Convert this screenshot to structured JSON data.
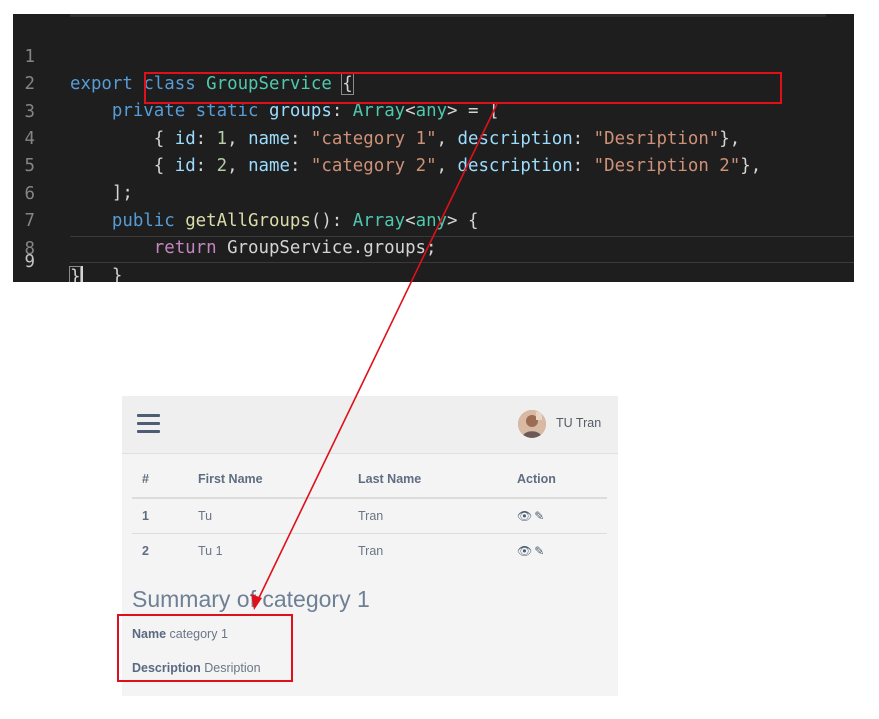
{
  "editor": {
    "lines": [
      {
        "num": "1"
      },
      {
        "num": "2"
      },
      {
        "num": "3"
      },
      {
        "num": "4"
      },
      {
        "num": "5"
      },
      {
        "num": "6"
      },
      {
        "num": "7"
      },
      {
        "num": "8"
      },
      {
        "num": "9"
      }
    ],
    "tokens": {
      "l1_export": "export",
      "l1_class": "class",
      "l1_name": "GroupService",
      "l1_brace": "{",
      "l2_private": "private",
      "l2_static": "static",
      "l2_groups": "groups",
      "l2_colon": ":",
      "l2_array": "Array",
      "l2_lt": "<",
      "l2_any": "any",
      "l2_gt": ">",
      "l2_eq": " = [",
      "l3_open": "{ ",
      "l3_id_key": "id",
      "l3_id_val": "1",
      "l3_name_key": "name",
      "l3_name_val": "\"category 1\"",
      "l3_desc_key": "description",
      "l3_desc_val": "\"Desription\"",
      "l3_close": "},",
      "l4_open": "{ ",
      "l4_id_key": "id",
      "l4_id_val": "2",
      "l4_name_key": "name",
      "l4_name_val": "\"category 2\"",
      "l4_desc_key": "description",
      "l4_desc_val": "\"Desription 2\"",
      "l4_close": "},",
      "l5_close": "];",
      "l6_public": "public",
      "l6_fn": "getAllGroups",
      "l6_parens": "():",
      "l6_array": "Array",
      "l6_lt": "<",
      "l6_any": "any",
      "l6_gt": ">",
      "l6_brace": " {",
      "l7_return": "return",
      "l7_cls": "GroupService",
      "l7_rest": ".groups;",
      "l8_close": "}",
      "l9_close": "}"
    }
  },
  "app": {
    "header": {
      "user_name": "TU Tran"
    },
    "table": {
      "columns": [
        "#",
        "First Name",
        "Last Name",
        "Action"
      ],
      "rows": [
        {
          "index": "1",
          "first": "Tu",
          "last": "Tran"
        },
        {
          "index": "2",
          "first": "Tu 1",
          "last": "Tran"
        }
      ]
    },
    "summary": {
      "title": "Summary of category 1",
      "name_label": "Name",
      "name_value": "category 1",
      "description_label": "Description",
      "description_value": "Desription"
    },
    "icons": {
      "view": "eye-icon",
      "edit": "edit-icon",
      "menu": "hamburger-menu-icon"
    }
  },
  "annotation": {
    "color": "#e0101a"
  }
}
